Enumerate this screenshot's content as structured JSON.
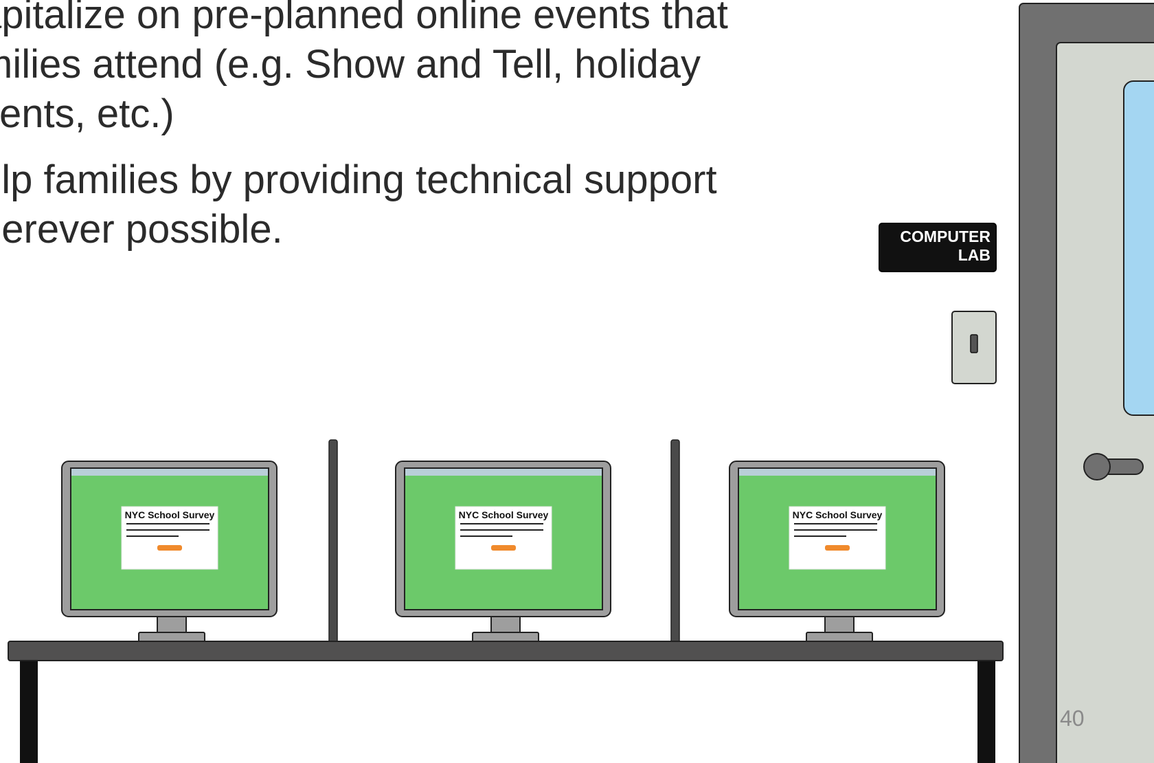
{
  "slide": {
    "bullets": [
      "apitalize on pre-planned online events that\nmilies attend (e.g. Show and Tell, holiday\nvents, etc.)",
      "elp families by providing technical support\nherever possible."
    ],
    "sign": {
      "line1": "COMPUTER",
      "line2": "LAB"
    },
    "monitor_screen_title": "NYC School Survey",
    "page_number": "40"
  },
  "colors": {
    "text": "#2b2b2b",
    "screen_green": "#6cc96a",
    "screen_bar": "#b9cfd8",
    "monitor_frame": "#9e9e9e",
    "desk_top": "#515050",
    "desk_legs": "#111111",
    "door_frame": "#707070",
    "door_panel": "#d3d7d0",
    "door_window": "#a4d6f2",
    "sign_bg": "#111111",
    "survey_button": "#f08a2c",
    "page_number": "#8a8a8a"
  },
  "icons": {
    "door_handle": "door-handle-icon",
    "light_switch": "light-switch-icon",
    "monitor": "monitor-icon"
  }
}
